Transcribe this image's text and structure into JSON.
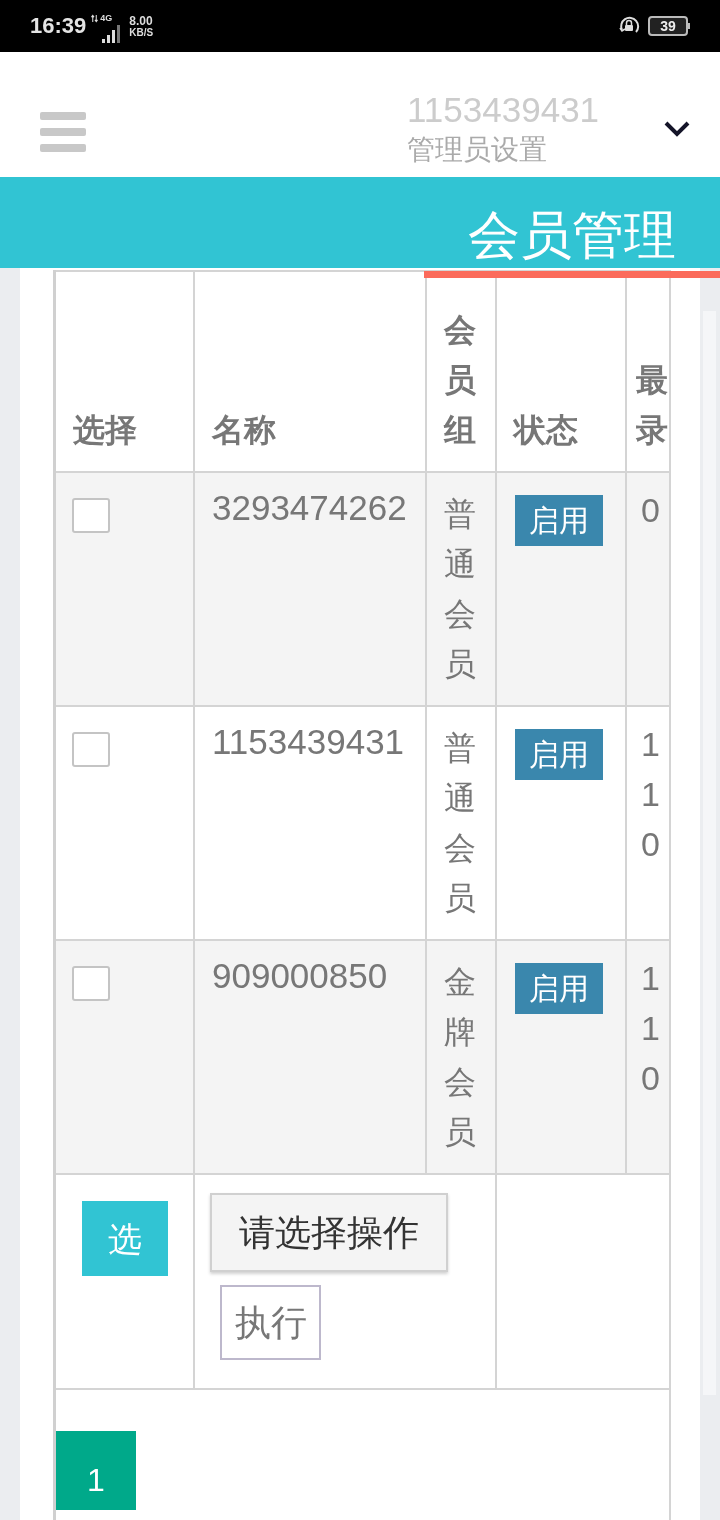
{
  "status_bar": {
    "time": "16:39",
    "network": "4G",
    "speed": "8.00",
    "speed_unit": "KB/S",
    "battery": "39"
  },
  "header": {
    "username": "1153439431",
    "subtitle": "管理员设置"
  },
  "title_bar": {
    "title": "会员管理"
  },
  "table": {
    "columns": [
      "选择",
      "名称",
      "会员组",
      "状态",
      "最录"
    ],
    "rows": [
      {
        "checked": false,
        "name": "3293474262",
        "group": "普通会员",
        "status": "启用",
        "column_5": "0"
      },
      {
        "checked": false,
        "name": "1153439431",
        "group": "普通会员",
        "status": "启用",
        "column_5": "110"
      },
      {
        "checked": false,
        "name": "909000850",
        "group": "金牌会员",
        "status": "启用",
        "column_5": "110"
      }
    ],
    "actions": {
      "select_button": "选",
      "operation_select": "请选择操作",
      "execute_button": "执行"
    }
  },
  "pagination": [
    {
      "label": "1",
      "selected": true
    }
  ]
}
